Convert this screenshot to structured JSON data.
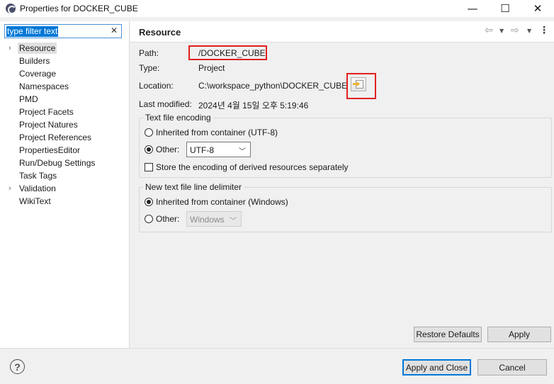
{
  "window": {
    "title": "Properties for DOCKER_CUBE",
    "minimize_glyph": "—",
    "maximize_glyph": "☐",
    "close_glyph": "✕"
  },
  "filter": {
    "value": "type filter text",
    "clear_glyph": "✕"
  },
  "tree": {
    "items": [
      {
        "label": "Resource",
        "expandable": true,
        "selected": true
      },
      {
        "label": "Builders"
      },
      {
        "label": "Coverage"
      },
      {
        "label": "Namespaces"
      },
      {
        "label": "PMD"
      },
      {
        "label": "Project Facets"
      },
      {
        "label": "Project Natures"
      },
      {
        "label": "Project References"
      },
      {
        "label": "PropertiesEditor"
      },
      {
        "label": "Run/Debug Settings"
      },
      {
        "label": "Task Tags"
      },
      {
        "label": "Validation",
        "expandable": true
      },
      {
        "label": "WikiText"
      }
    ]
  },
  "page": {
    "title": "Resource",
    "nav": {
      "back_icon": "back-arrow-icon",
      "forward_icon": "forward-arrow-icon",
      "back_glyph": "⇦",
      "forward_glyph": "⇨",
      "caret_glyph": "▼",
      "menu_glyph": "⋮"
    },
    "path_label": "Path:",
    "path_value": "/DOCKER_CUBE",
    "type_label": "Type:",
    "type_value": "Project",
    "location_label": "Location:",
    "location_value": "C:\\workspace_python\\DOCKER_CUBE",
    "modified_label": "Last modified:",
    "modified_value": "2024년 4월 15일 오후 5:19:46",
    "encoding": {
      "legend": "Text file encoding",
      "inherited_label": "Inherited from container (UTF-8)",
      "other_label": "Other:",
      "other_value": "UTF-8",
      "selected": "other",
      "derived_label": "Store the encoding of derived resources separately",
      "derived_checked": false
    },
    "delimiter": {
      "legend": "New text file line delimiter",
      "inherited_label": "Inherited from container (Windows)",
      "other_label": "Other:",
      "other_value": "Windows",
      "selected": "inherited"
    },
    "restore_label": "Restore Defaults",
    "apply_label": "Apply"
  },
  "footer": {
    "help_glyph": "?",
    "apply_close_label": "Apply and Close",
    "cancel_label": "Cancel"
  },
  "colors": {
    "highlight_border": "#e02020",
    "selection": "#0078d7"
  }
}
